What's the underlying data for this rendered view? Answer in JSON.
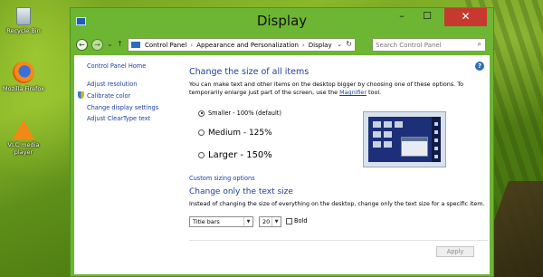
{
  "desktop": {
    "icons": [
      {
        "label": "Recycle Bin",
        "icon": "recycle-bin-icon"
      },
      {
        "label": "Mozilla Firefox",
        "icon": "firefox-icon"
      },
      {
        "label": "VLC media player",
        "icon": "vlc-icon"
      }
    ]
  },
  "window": {
    "title": "Display",
    "controls": {
      "minimize": "–",
      "maximize": "☐",
      "close": "✕"
    }
  },
  "nav": {
    "back": "←",
    "forward": "→",
    "recent": "⌄",
    "up": "↑",
    "breadcrumbs": [
      "Control Panel",
      "Appearance and Personalization",
      "Display"
    ],
    "separator": "›",
    "address_dropdown": "⌄",
    "refresh": "↻",
    "search_placeholder": "Search Control Panel",
    "search_icon": "⌕"
  },
  "sidebar": {
    "home": "Control Panel Home",
    "links": [
      "Adjust resolution",
      "Calibrate color",
      "Change display settings",
      "Adjust ClearType text"
    ]
  },
  "main": {
    "help": "?",
    "size_heading": "Change the size of all items",
    "size_desc_1": "You can make text and other items on the desktop bigger by choosing one of these options. To temporarily enlarge just part of the screen, use the ",
    "magnifier_link": "Magnifier",
    "size_desc_2": " tool.",
    "options": [
      {
        "label": "Smaller - 100% (default)",
        "selected": true
      },
      {
        "label": "Medium - 125%",
        "selected": false
      },
      {
        "label": "Larger - 150%",
        "selected": false
      }
    ],
    "custom_sizing": "Custom sizing options",
    "text_heading": "Change only the text size",
    "text_desc": "Instead of changing the size of everything on the desktop, change only the text size for a specific item.",
    "element_select": "Title bars",
    "size_select": "20",
    "bold_label": "Bold",
    "bold_checked": false,
    "apply": "Apply"
  },
  "colors": {
    "window_frame": "#6db634",
    "link": "#1a3f9e",
    "heading": "#1c3fa0",
    "close_button": "#c7392f"
  }
}
